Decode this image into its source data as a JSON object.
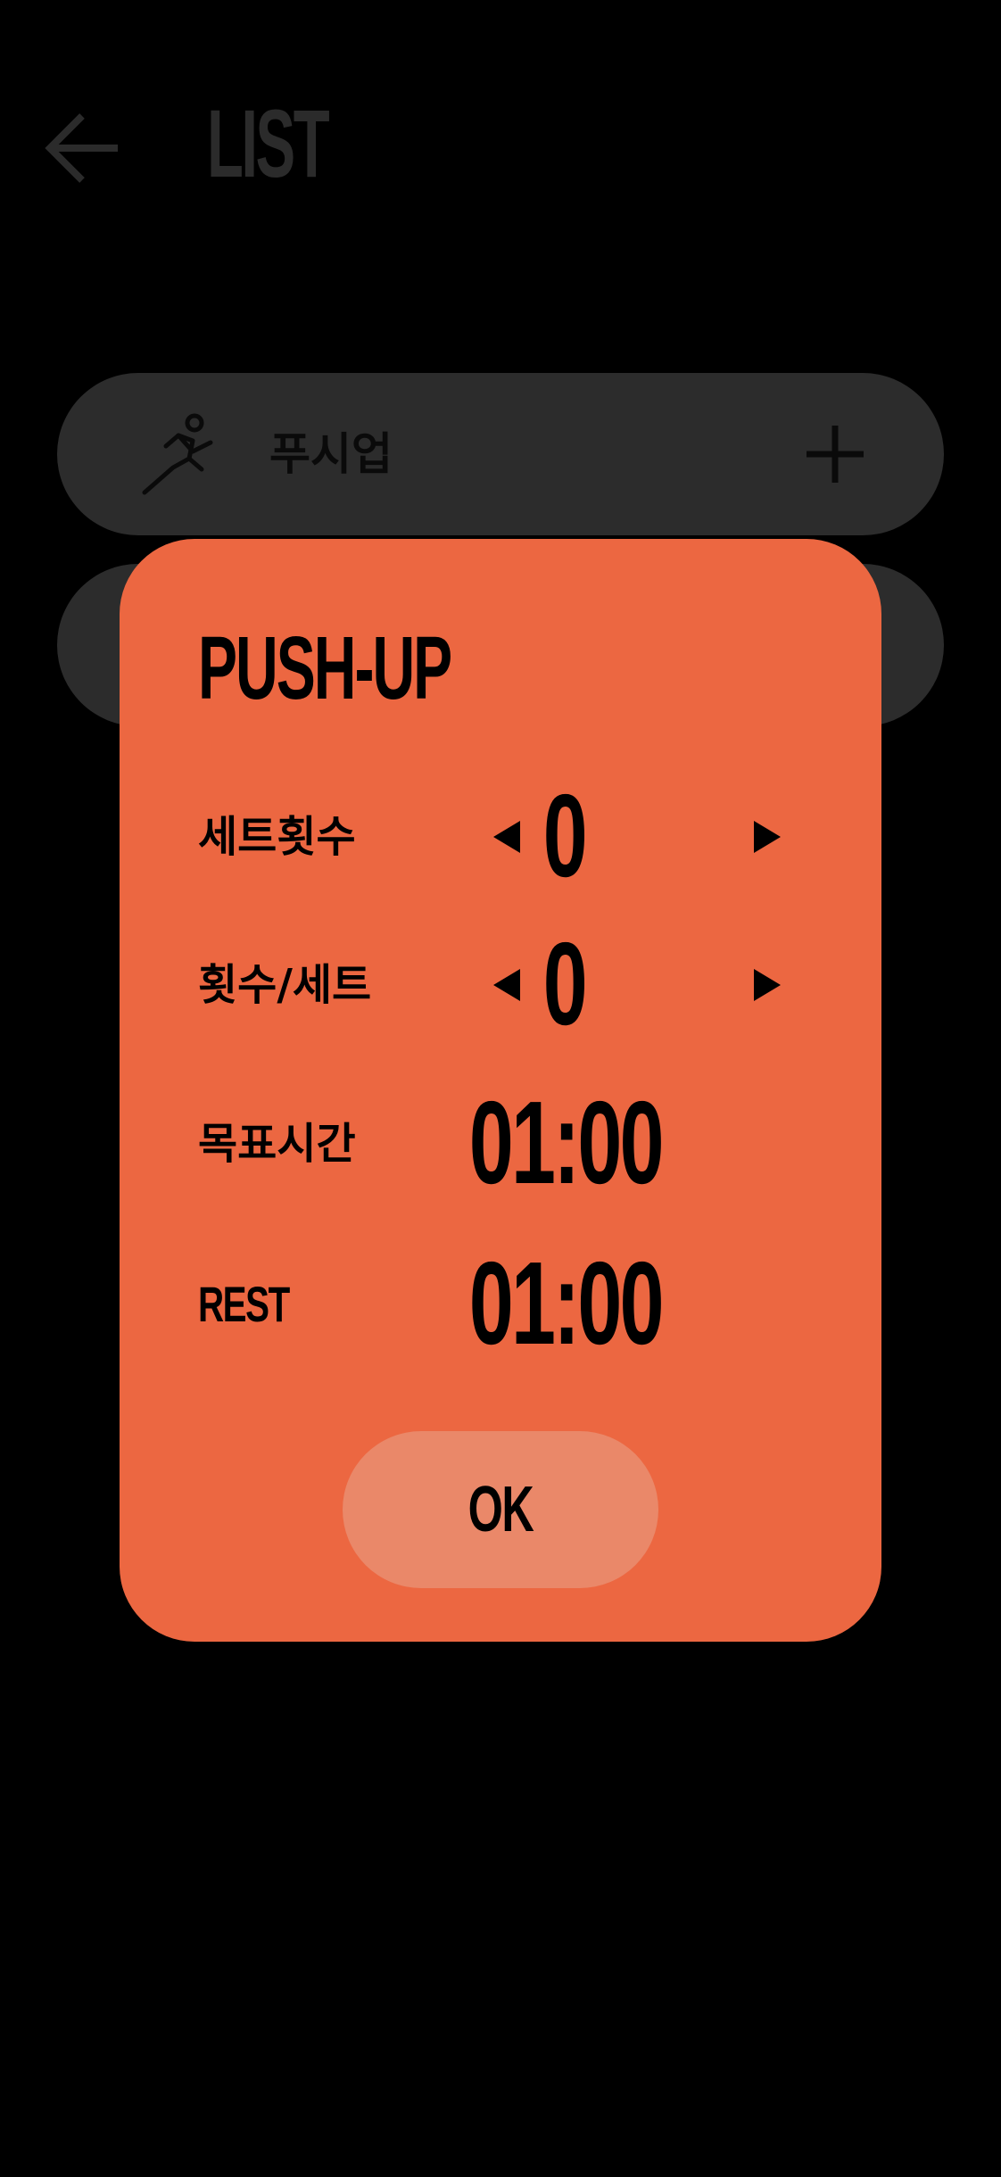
{
  "header": {
    "title": "LIST",
    "back_icon": "arrow-left-icon",
    "title_color": "#2b2b2b"
  },
  "list": {
    "items": [
      {
        "label": "푸시업",
        "icon": "running-person-icon",
        "action_icon": "plus-icon"
      },
      {
        "label": "",
        "icon": "",
        "action_icon": ""
      }
    ],
    "row_color": "#2c2c2c"
  },
  "modal": {
    "title": "PUSH-UP",
    "background_color": "#ec6741",
    "sets": {
      "label": "세트횟수",
      "value": "0",
      "decrease_icon": "triangle-left-icon",
      "increase_icon": "triangle-right-icon"
    },
    "reps_per_set": {
      "label": "횟수/세트",
      "value": "0",
      "decrease_icon": "triangle-left-icon",
      "increase_icon": "triangle-right-icon"
    },
    "target_time": {
      "label": "목표시간",
      "value": "01:00"
    },
    "rest": {
      "label": "REST",
      "value": "01:00"
    },
    "ok_button": {
      "label": "OK",
      "color": "#ea8869"
    }
  }
}
